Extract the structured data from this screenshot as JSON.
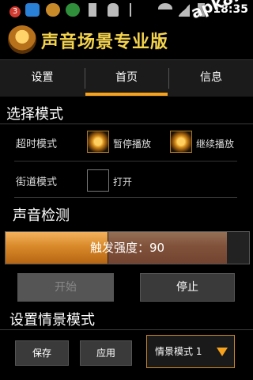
{
  "status_bar": {
    "notification_badge": "3",
    "time": "18:35",
    "icons": [
      "notification-badge-icon",
      "app-store-icon",
      "app-icon",
      "game-icon",
      "sd-card-icon",
      "android-icon",
      "usb-icon",
      "wifi-icon",
      "signal-icon",
      "battery-icon"
    ]
  },
  "watermark": "apk8.com",
  "header": {
    "title": "声音场景专业版"
  },
  "tabs": [
    {
      "label": "设置"
    },
    {
      "label": "首页",
      "active": true
    },
    {
      "label": "信息"
    }
  ],
  "mode_section": {
    "title": "选择模式",
    "timeout_mode": {
      "label": "超时模式",
      "options": [
        {
          "label": "暂停播放",
          "checked": true
        },
        {
          "label": "继续播放",
          "checked": true
        }
      ]
    },
    "street_mode": {
      "label": "街道模式",
      "option": {
        "label": "打开",
        "checked": false
      }
    }
  },
  "detection_section": {
    "title": "声音检测",
    "trigger_text": "触发强度：90",
    "level_percent": 42
  },
  "actions": {
    "start": "开始",
    "stop": "停止"
  },
  "scene_section": {
    "title": "设置情景模式",
    "save": "保存",
    "apply": "应用",
    "selected_scene": "情景模式 1"
  },
  "colors": {
    "accent": "#f6a21c",
    "title_yellow": "#f4d34d"
  }
}
